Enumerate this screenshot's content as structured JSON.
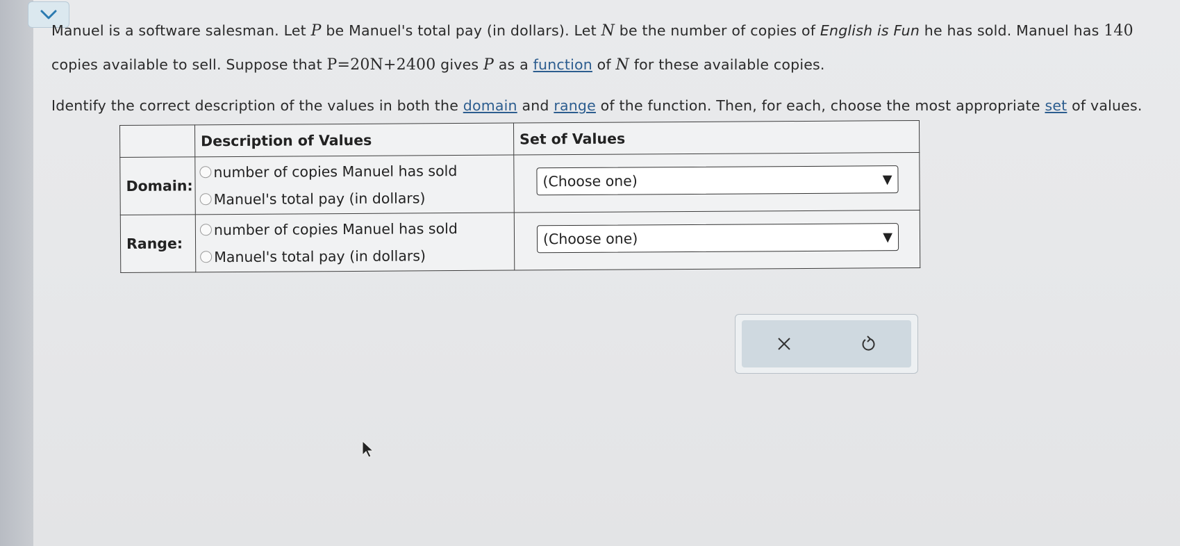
{
  "header": {
    "collapse_icon": "chevron-down-icon"
  },
  "problem": {
    "s1": "Manuel is a software salesman. Let ",
    "var_p": "P",
    "s2": " be Manuel's total pay (in dollars). Let ",
    "var_n": "N",
    "s3": " be the number of copies of ",
    "book": "English is Fun",
    "s4": " he has sold. Manuel has ",
    "num_copies": "140",
    "s5": " copies available to sell. Suppose that ",
    "equation": "P=20N+2400",
    "s6": " gives ",
    "s7": " as a ",
    "link_function": "function",
    "s8": " of ",
    "s9": " for these available copies."
  },
  "instruction": {
    "s1": "Identify the correct description of the values in both the ",
    "link_domain": "domain",
    "s2": " and ",
    "link_range": "range",
    "s3": " of the function. Then, for each, choose the most appropriate ",
    "link_set": "set",
    "s4": " of values."
  },
  "table": {
    "header_description": "Description of Values",
    "header_set": "Set of Values",
    "rows": [
      {
        "label": "Domain:",
        "options": [
          "number of copies Manuel has sold",
          "Manuel's total pay (in dollars)"
        ],
        "select_value": "(Choose one)"
      },
      {
        "label": "Range:",
        "options": [
          "number of copies Manuel has sold",
          "Manuel's total pay (in dollars)"
        ],
        "select_value": "(Choose one)"
      }
    ]
  },
  "actions": {
    "clear_icon": "close-icon",
    "undo_icon": "undo-icon",
    "clear_glyph": "✕"
  },
  "colors": {
    "link": "#2c5d8f",
    "action_panel": "#cfd9e0",
    "chevron": "#2a7ab0"
  }
}
